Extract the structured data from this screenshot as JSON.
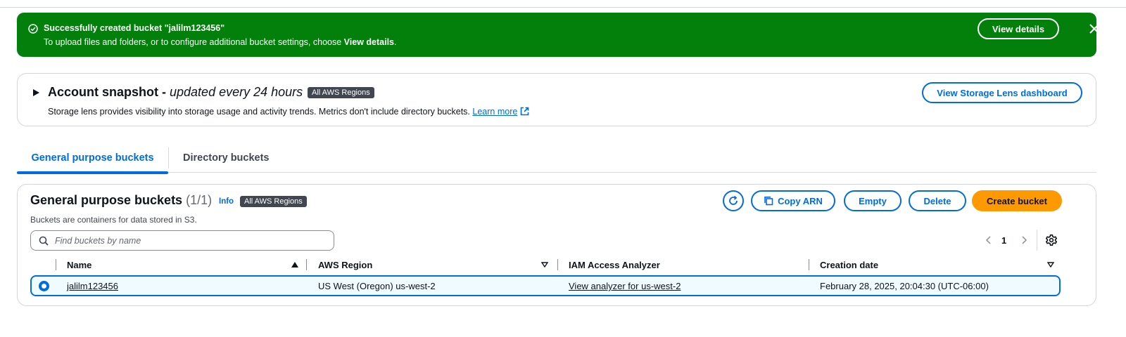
{
  "flash": {
    "title": "Successfully created bucket \"jalilm123456\"",
    "text_prefix": "To upload files and folders, or to configure additional bucket settings, choose ",
    "text_bold": "View details",
    "text_suffix": ".",
    "button_label": "View details",
    "color": "#037f0c"
  },
  "snapshot": {
    "title": "Account snapshot",
    "separator": " - ",
    "subtitle": "updated every 24 hours",
    "badge": "All AWS Regions",
    "description": "Storage lens provides visibility into storage usage and activity trends. Metrics don't include directory buckets. ",
    "learn_more": "Learn more",
    "button_label": "View Storage Lens dashboard"
  },
  "tabs": [
    {
      "label": "General purpose buckets",
      "active": true
    },
    {
      "label": "Directory buckets",
      "active": false
    }
  ],
  "buckets": {
    "title": "General purpose buckets",
    "count": "(1/1)",
    "info": "Info",
    "badge": "All AWS Regions",
    "description": "Buckets are containers for data stored in S3.",
    "actions": {
      "refresh_icon": "refresh-icon",
      "copy_arn": "Copy ARN",
      "empty": "Empty",
      "delete": "Delete",
      "create": "Create bucket"
    },
    "search_placeholder": "Find buckets by name",
    "page": "1",
    "columns": [
      "Name",
      "AWS Region",
      "IAM Access Analyzer",
      "Creation date"
    ],
    "rows": [
      {
        "name": "jalilm123456",
        "region": "US West (Oregon) us-west-2",
        "analyzer": "View analyzer for us-west-2",
        "created": "February 28, 2025, 20:04:30 (UTC-06:00)",
        "selected": true
      }
    ]
  },
  "colors": {
    "accent": "#006ce0",
    "primary_button": "#ff9900",
    "success": "#037f0c"
  }
}
